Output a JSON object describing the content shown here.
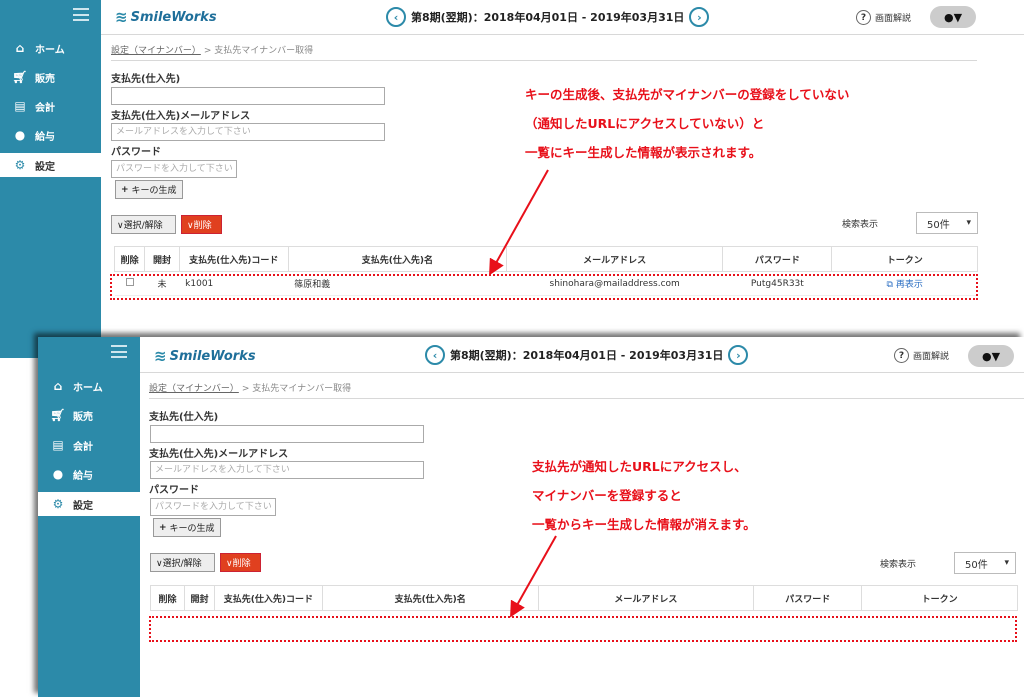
{
  "app": {
    "logo": "SmileWorks",
    "period": "第8期(翌期)：2018年04月01日 - 2019年03月31日",
    "help": "画面解説",
    "user_caret": "▼"
  },
  "nav": [
    {
      "label": "ホーム",
      "icon": "home-icon"
    },
    {
      "label": "販売",
      "icon": "cart-icon"
    },
    {
      "label": "会計",
      "icon": "calculator-icon"
    },
    {
      "label": "給与",
      "icon": "money-bag-icon"
    },
    {
      "label": "設定",
      "icon": "gear-icon"
    }
  ],
  "breadcrumb": {
    "link": "設定（マイナンバー）",
    "sep": ">",
    "current": "支払先マイナンバー取得"
  },
  "form": {
    "payee_label": "支払先(仕入先)",
    "email_label": "支払先(仕入先)メールアドレス",
    "email_placeholder": "メールアドレスを入力して下さい",
    "password_label": "パスワード",
    "password_placeholder": "パスワードを入力して下さい",
    "generate_button": "キーの生成"
  },
  "toolbar": {
    "select_toggle": "∨選択/解除",
    "delete": "∨削除",
    "per_page_label": "検索表示",
    "per_page_value": "50件"
  },
  "table": {
    "columns": [
      "削除",
      "開封",
      "支払先(仕入先)コード",
      "支払先(仕入先)名",
      "メールアドレス",
      "パスワード",
      "トークン"
    ],
    "row": {
      "opened": "未",
      "code": "k1001",
      "name": "篠原和義",
      "email": "shinohara@mailaddress.com",
      "password": "Putg45R33t",
      "token": "再表示"
    }
  },
  "annotations": {
    "top": [
      "キーの生成後、支払先がマイナンバーの登録をしていない",
      "（通知したURLにアクセスしていない）と",
      "一覧にキー生成した情報が表示されます。"
    ],
    "bottom": [
      "支払先が通知したURLにアクセスし、",
      "マイナンバーを登録すると",
      "一覧からキー生成した情報が消えます。"
    ]
  },
  "colors": {
    "sidebar": "#2c8aa9",
    "annotation": "#e8101a",
    "delete_button": "#e0401f"
  }
}
